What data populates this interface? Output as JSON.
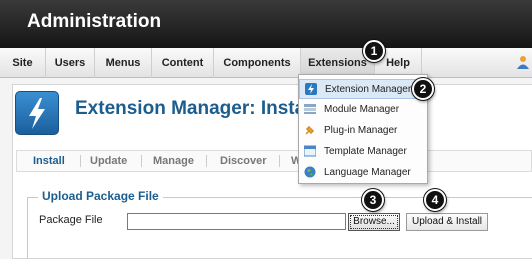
{
  "header": {
    "title": "Administration"
  },
  "menubar": {
    "items": [
      {
        "label": "Site"
      },
      {
        "label": "Users"
      },
      {
        "label": "Menus"
      },
      {
        "label": "Content"
      },
      {
        "label": "Components"
      },
      {
        "label": "Extensions"
      },
      {
        "label": "Help"
      }
    ],
    "active": "Extensions"
  },
  "page": {
    "title": "Extension Manager: Install",
    "icon": "lightning-icon"
  },
  "tabs": [
    {
      "label": "Install"
    },
    {
      "label": "Update"
    },
    {
      "label": "Manage"
    },
    {
      "label": "Discover"
    },
    {
      "label": "W"
    }
  ],
  "upload": {
    "legend": "Upload Package File",
    "field_label": "Package File",
    "field_value": "",
    "browse_label": "Browse...",
    "upload_label": "Upload & Install"
  },
  "dropdown": {
    "items": [
      {
        "label": "Extension Manager",
        "icon": "lightning-icon"
      },
      {
        "label": "Module Manager",
        "icon": "module-icon"
      },
      {
        "label": "Plug-in Manager",
        "icon": "plugin-icon"
      },
      {
        "label": "Template Manager",
        "icon": "template-icon"
      },
      {
        "label": "Language Manager",
        "icon": "globe-icon"
      }
    ],
    "highlighted": "Extension Manager"
  },
  "badges": [
    "1",
    "2",
    "3",
    "4"
  ],
  "colors": {
    "header_bg": "#1e1e1e",
    "accent": "#1b5d8e",
    "highlight": "#dbe8f6"
  }
}
